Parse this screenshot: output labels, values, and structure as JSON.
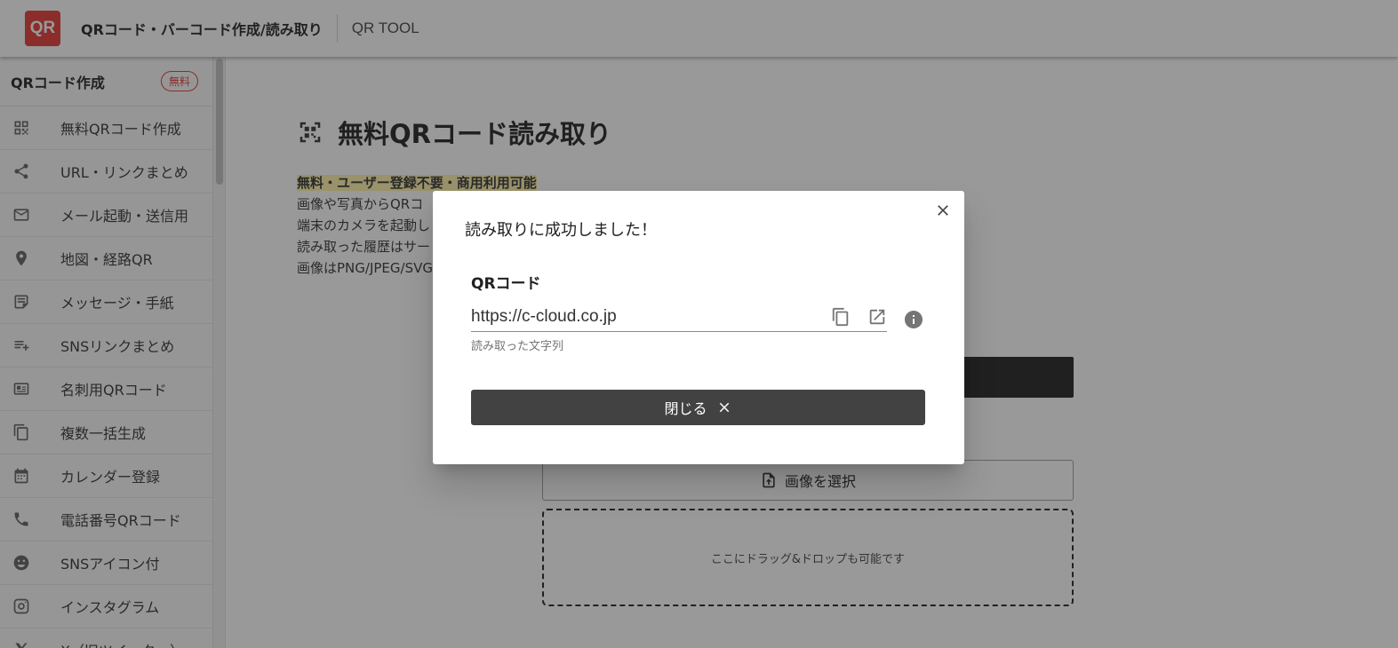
{
  "header": {
    "logo_text": "QR",
    "app_title": "QRコード・バーコード作成/読み取り",
    "sub_title": "QR TOOL"
  },
  "sidebar": {
    "title": "QRコード作成",
    "badge": "無料",
    "items": [
      {
        "label": "無料QRコード作成",
        "icon": "qr-grid-icon"
      },
      {
        "label": "URL・リンクまとめ",
        "icon": "share-icon"
      },
      {
        "label": "メール起動・送信用",
        "icon": "mail-icon"
      },
      {
        "label": "地図・経路QR",
        "icon": "map-pin-icon"
      },
      {
        "label": "メッセージ・手紙",
        "icon": "note-icon"
      },
      {
        "label": "SNSリンクまとめ",
        "icon": "playlist-add-icon"
      },
      {
        "label": "名刺用QRコード",
        "icon": "contact-card-icon"
      },
      {
        "label": "複数一括生成",
        "icon": "copy-icon"
      },
      {
        "label": "カレンダー登録",
        "icon": "calendar-icon"
      },
      {
        "label": "電話番号QRコード",
        "icon": "phone-icon"
      },
      {
        "label": "SNSアイコン付",
        "icon": "smiley-icon"
      },
      {
        "label": "インスタグラム",
        "icon": "instagram-icon"
      },
      {
        "label": "X（旧ツイッター）",
        "icon": "x-icon"
      }
    ]
  },
  "main": {
    "title": "無料QRコード読み取り",
    "intro": [
      "無料・ユーザー登録不要・商用利用可能",
      "画像や写真からQRコ",
      "端末のカメラを起動し",
      "読み取った履歴はサー",
      "画像はPNG/JPEG/SVG"
    ],
    "select_image_label": "画像を選択",
    "drop_hint": "ここにドラッグ&ドロップも可能です"
  },
  "dialog": {
    "title": "読み取りに成功しました！",
    "field_label": "QRコード",
    "field_value": "https://c-cloud.co.jp",
    "field_hint": "読み取った文字列",
    "close_label": "閉じる"
  }
}
